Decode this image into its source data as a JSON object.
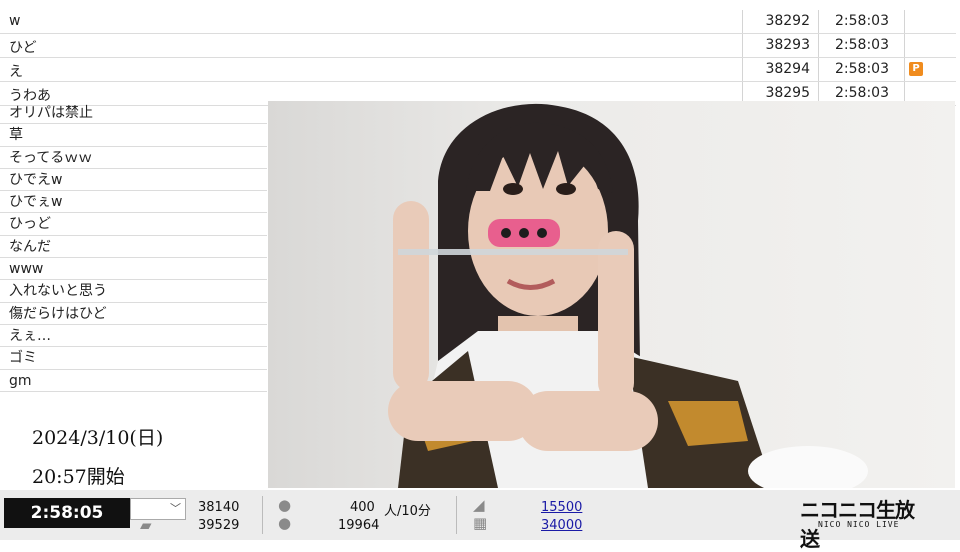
{
  "top_comments": [
    {
      "text": "w",
      "number": "38292",
      "time": "2:58:03",
      "badge": ""
    },
    {
      "text": "ひど",
      "number": "38293",
      "time": "2:58:03",
      "badge": ""
    },
    {
      "text": "え",
      "number": "38294",
      "time": "2:58:03",
      "badge": "P"
    },
    {
      "text": "うわあ",
      "number": "38295",
      "time": "2:58:03",
      "badge": ""
    }
  ],
  "left_comments": [
    "オリパは禁止",
    "草",
    "そってるｗｗ",
    "ひでえw",
    "ひでぇw",
    "ひっど",
    "なんだ",
    "www",
    "入れないと思う",
    "傷だらけはひど",
    "えぇ…",
    "ゴミ",
    "gm"
  ],
  "broadcast": {
    "date": "2024/3/10(日)",
    "start": "20:57開始"
  },
  "bottom": {
    "elapsed": "2:58:05",
    "count_a": "38140",
    "count_b": "39529",
    "viewers_rate": "400",
    "viewers_rate_unit": "人/10分",
    "total_viewers": "19964",
    "ad_points": "15500",
    "gift_points": "34000"
  },
  "logo": {
    "main": "ニコニコ生放送",
    "sub": "NICO NICO LIVE"
  },
  "colors": {
    "badge": "#f08c1e",
    "link": "#1a1aa6"
  }
}
